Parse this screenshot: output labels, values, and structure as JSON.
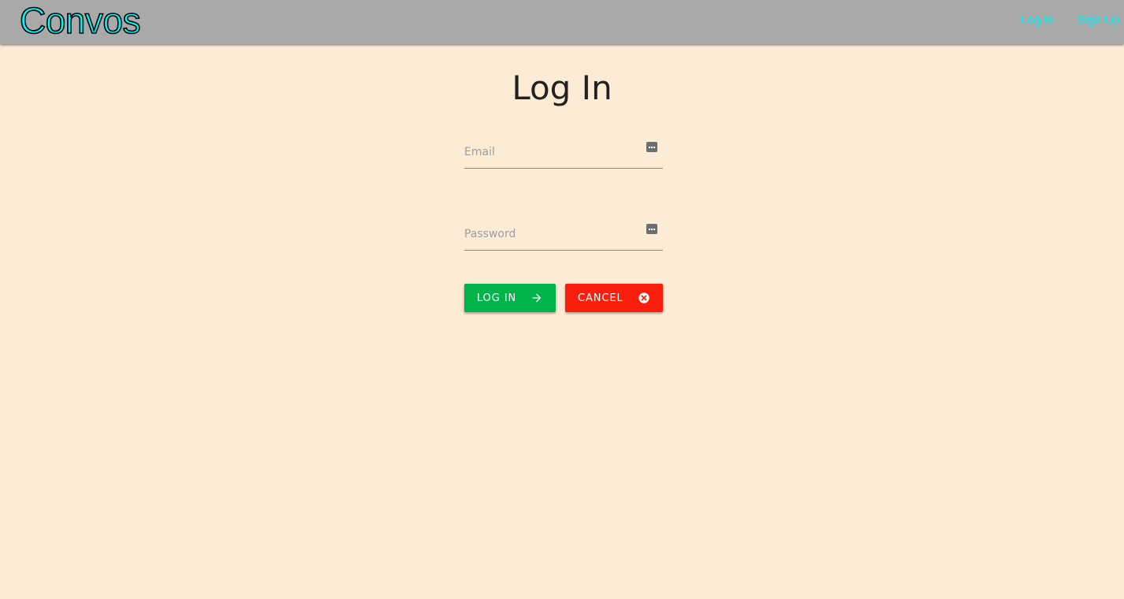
{
  "nav": {
    "brand": "Convos",
    "links": [
      "Log In",
      "Sign Up"
    ]
  },
  "page": {
    "title": "Log In"
  },
  "form": {
    "email_placeholder": "Email",
    "email_value": "",
    "password_placeholder": "Password",
    "password_value": "",
    "login_label": "LOG IN",
    "cancel_label": "CANCEL"
  },
  "icons": {
    "login_button": "arrow-right-icon",
    "cancel_button": "close-circle-icon",
    "field_autofill": "password-manager-icon"
  },
  "colors": {
    "background": "#fcebd5",
    "navbar": "#a9a9a9",
    "brand": "#00f6f6",
    "nav_link": "#00eef2",
    "login_button": "#00b44a",
    "cancel_button": "#fa1f0c"
  }
}
